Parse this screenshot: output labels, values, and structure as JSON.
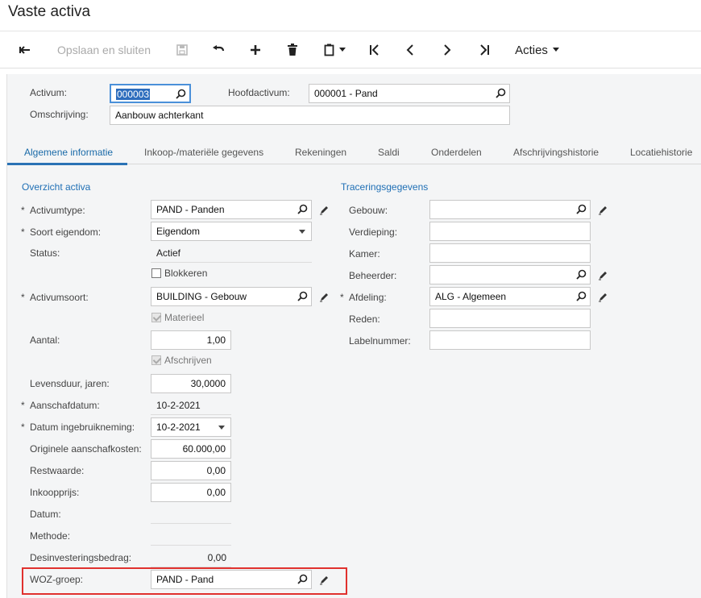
{
  "page": {
    "title": "Vaste activa"
  },
  "toolbar": {
    "save_close_label": "Opslaan en sluiten",
    "actions_label": "Acties"
  },
  "header": {
    "asset_label": "Activum:",
    "asset_value": "000003",
    "parent_label": "Hoofdactivum:",
    "parent_value": "000001 - Pand",
    "description_label": "Omschrijving:",
    "description_value": "Aanbouw achterkant"
  },
  "tabs": [
    {
      "label": "Algemene informatie"
    },
    {
      "label": "Inkoop-/materiële gegevens"
    },
    {
      "label": "Rekeningen"
    },
    {
      "label": "Saldi"
    },
    {
      "label": "Onderdelen"
    },
    {
      "label": "Afschrijvingshistorie"
    },
    {
      "label": "Locatiehistorie"
    }
  ],
  "overview": {
    "section_title": "Overzicht activa",
    "asset_type_label": "Activumtype:",
    "asset_type_value": "PAND - Panden",
    "ownership_label": "Soort eigendom:",
    "ownership_value": "Eigendom",
    "status_label": "Status:",
    "status_value": "Actief",
    "block_label": "Blokkeren",
    "asset_class_label": "Activumsoort:",
    "asset_class_value": "BUILDING - Gebouw",
    "material_label": "Materieel",
    "quantity_label": "Aantal:",
    "quantity_value": "1,00",
    "depreciate_label": "Afschrijven",
    "useful_life_label": "Levensduur, jaren:",
    "useful_life_value": "30,0000",
    "acquisition_date_label": "Aanschafdatum:",
    "acquisition_date_value": "10-2-2021",
    "in_service_date_label": "Datum ingebruikneming:",
    "in_service_date_value": "10-2-2021",
    "orig_cost_label": "Originele aanschafkosten:",
    "orig_cost_value": "60.000,00",
    "salvage_label": "Restwaarde:",
    "salvage_value": "0,00",
    "purchase_price_label": "Inkoopprijs:",
    "purchase_price_value": "0,00",
    "date_label": "Datum:",
    "method_label": "Methode:",
    "disposal_label": "Desinvesteringsbedrag:",
    "disposal_value": "0,00",
    "woz_label": "WOZ-groep:",
    "woz_value": "PAND - Pand"
  },
  "tracing": {
    "section_title": "Traceringsgegevens",
    "building_label": "Gebouw:",
    "floor_label": "Verdieping:",
    "room_label": "Kamer:",
    "custodian_label": "Beheerder:",
    "department_label": "Afdeling:",
    "department_value": "ALG - Algemeen",
    "reason_label": "Reden:",
    "tag_label": "Labelnummer:"
  }
}
